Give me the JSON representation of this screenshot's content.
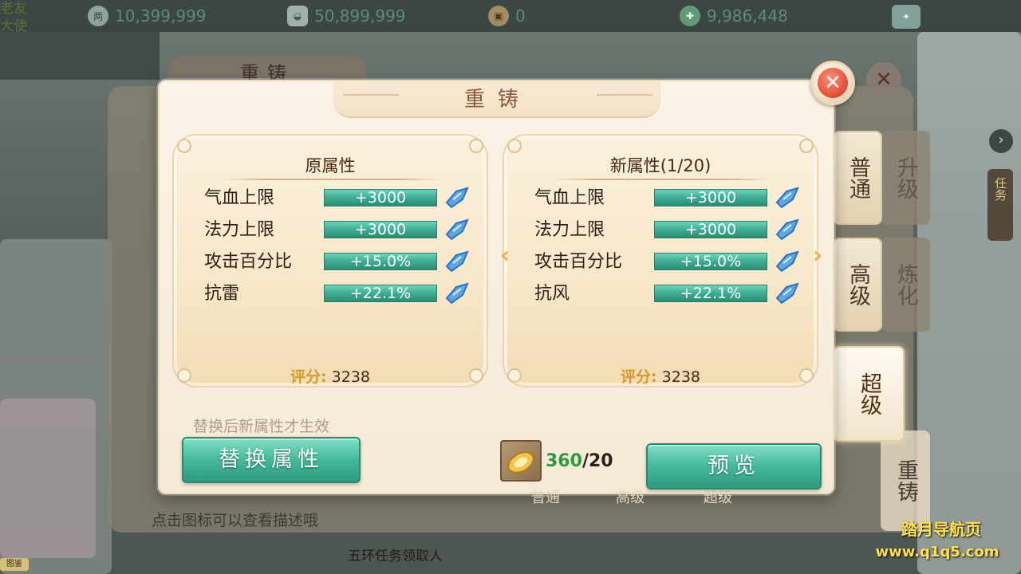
{
  "topbar": {
    "npc_lines": [
      "老友",
      "大使"
    ],
    "resources": [
      {
        "icon": "silver-coin-icon",
        "value": "10,399,999"
      },
      {
        "icon": "silver-ingot-icon",
        "value": "50,899,999"
      },
      {
        "icon": "copper-coin-icon",
        "value": "0"
      },
      {
        "icon": "jade-currency-icon",
        "value": "9,986,448"
      }
    ]
  },
  "background": {
    "panel_title": "重铸",
    "hint": "点击图标可以查看描述哦",
    "quest": "五环任务领取人",
    "bottom_badge": "图鉴"
  },
  "side_tabs": {
    "normal": "普通",
    "advanced": "高级",
    "super": "超级",
    "ghost_upgrade": "升级",
    "ghost_refine": "炼化",
    "ghost_recast": "重铸"
  },
  "task_strip": "任务",
  "dialog": {
    "title": "重铸",
    "original": {
      "title": "原属性",
      "attributes": [
        {
          "name": "气血上限",
          "value": "+3000"
        },
        {
          "name": "法力上限",
          "value": "+3000"
        },
        {
          "name": "攻击百分比",
          "value": "+15.0%"
        },
        {
          "name": "抗雷",
          "value": "+22.1%"
        }
      ],
      "score_label": "评分:",
      "score": "3238"
    },
    "new": {
      "title": "新属性(1/20)",
      "attributes": [
        {
          "name": "气血上限",
          "value": "+3000"
        },
        {
          "name": "法力上限",
          "value": "+3000"
        },
        {
          "name": "攻击百分比",
          "value": "+15.0%"
        },
        {
          "name": "抗风",
          "value": "+22.1%"
        }
      ],
      "score_label": "评分:",
      "score": "3238"
    },
    "replace_hint": "替换后新属性才生效",
    "replace_button": "替换属性",
    "preview_button": "预览",
    "material_have": "360",
    "material_need": "/20",
    "ghost_tabs": [
      "普通",
      "高级",
      "超级"
    ]
  },
  "watermark": {
    "line1": "踏月导航页",
    "line2": "www.q1q5.com"
  },
  "colors": {
    "accent_teal": "#45b89b",
    "score_gold": "#d49a2a",
    "close_red": "#e14a35"
  }
}
